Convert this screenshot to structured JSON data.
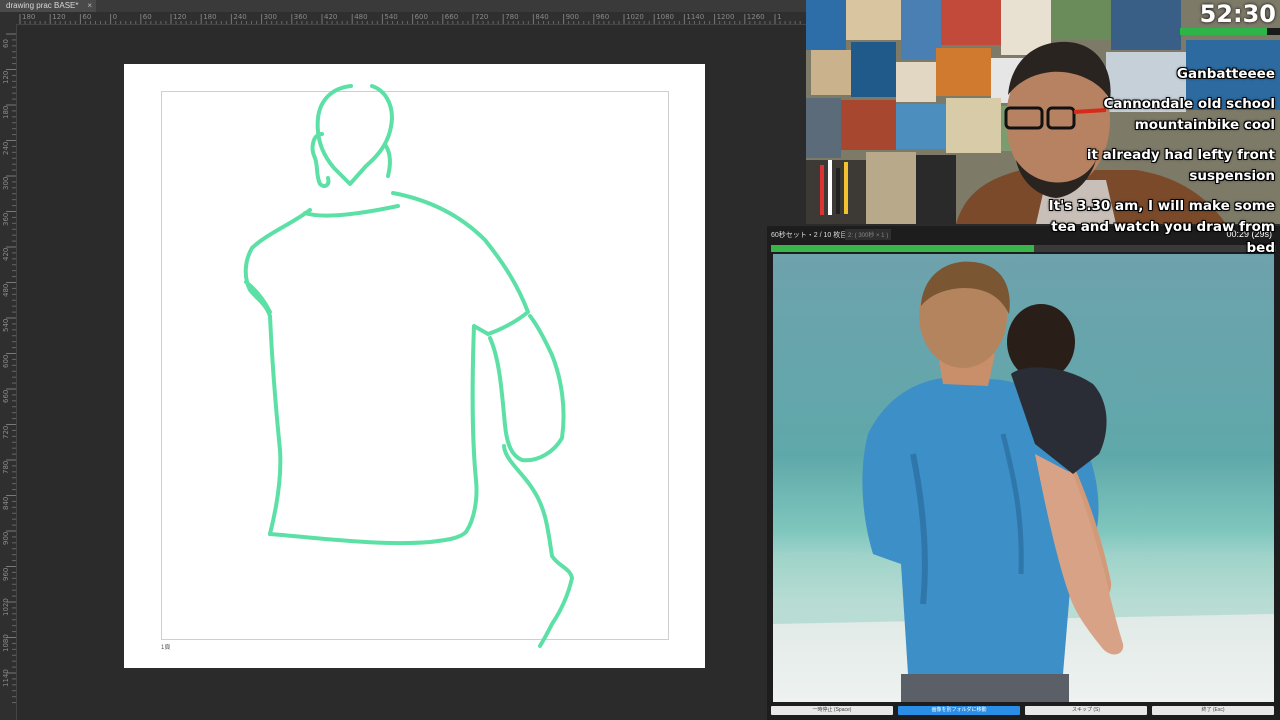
{
  "app": {
    "document_tab": "drawing prac BASE*",
    "tab_close_glyph": "×",
    "ruler_top": [
      "180",
      "120",
      "60",
      "0",
      "60",
      "120",
      "180",
      "240",
      "300",
      "360",
      "420",
      "480",
      "540",
      "600",
      "660",
      "720",
      "780",
      "840",
      "900",
      "960",
      "1020",
      "1080",
      "1140",
      "1200",
      "1260",
      "1"
    ],
    "ruler_left": [
      "60",
      "120",
      "180",
      "240",
      "300",
      "360",
      "420",
      "480",
      "540",
      "600",
      "660",
      "720",
      "780",
      "840",
      "900",
      "960",
      "1020",
      "1080",
      "1140"
    ],
    "canvas_label": "1頁"
  },
  "timer": {
    "display": "52:30",
    "bar_fill": 0.87,
    "bar_color": "#2db54a"
  },
  "chat": [
    {
      "lines": [
        "Ganbatteeee"
      ]
    },
    {
      "lines": [
        "Cannondale old school",
        "mountainbike cool"
      ]
    },
    {
      "lines": [
        "it already had lefty front",
        "suspension"
      ]
    },
    {
      "lines": [
        "It's 3.30 am, I will make some",
        "tea and watch you draw from",
        "bed"
      ]
    }
  ],
  "viewer": {
    "title": "60秒セット・2 / 10 枚目",
    "chip": "2: ( 300秒 × 1 )",
    "time_remaining": "00:29 (29s)",
    "progress": 0.52,
    "progress_color": "#39b54a",
    "buttons": [
      "一時停止 (Space)",
      "画像を別フォルダに移動",
      "スキップ (S)",
      "終了 (Esc)"
    ]
  },
  "colors": {
    "stroke": "#5ce0a6",
    "canvas": "#ffffff",
    "workspace": "#2b2b2b",
    "primary_button": "#2a8ee6"
  }
}
